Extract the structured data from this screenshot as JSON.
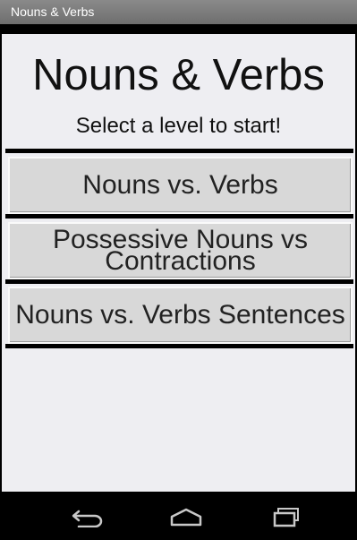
{
  "statusbar": {
    "window_title": "Nouns & Verbs"
  },
  "header": {
    "title": "Nouns & Verbs",
    "subtitle": "Select a level to start!"
  },
  "levels": [
    {
      "label": "Nouns vs. Verbs"
    },
    {
      "label": "Possessive Nouns vs Contractions"
    },
    {
      "label": "Nouns vs. Verbs Sentences"
    }
  ],
  "navbar": {
    "icons": [
      "back-icon",
      "home-icon",
      "recent-apps-icon"
    ],
    "icon_color": "#c8c8c8"
  },
  "colors": {
    "background": "#eeeef2",
    "button": "#d8d8d8",
    "title_bar": "#777777"
  }
}
